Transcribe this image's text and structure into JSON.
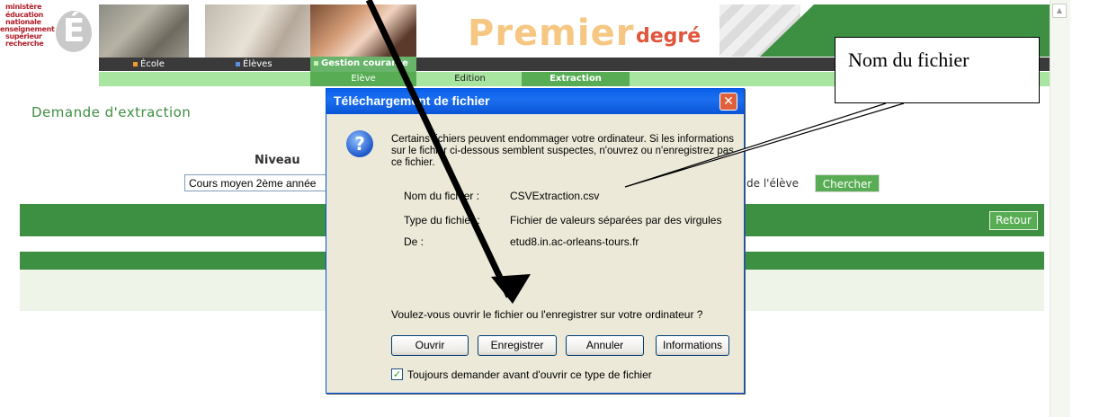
{
  "header": {
    "logo_lines": [
      "ministère",
      "éducation",
      "nationale",
      "enseignement",
      "supérieur",
      "recherche"
    ],
    "logo_letter": "É",
    "title_main": "Premier",
    "title_sub": "degré",
    "nav": [
      "École",
      "Élèves",
      "Gestion courante"
    ],
    "subnav": [
      "Elève",
      "Edition",
      "Extraction"
    ],
    "colors": {
      "accent_green": "#3d8f42",
      "light_green": "#a8e5a0",
      "title_orange": "#f6c783",
      "title_red": "#e0553b"
    }
  },
  "page": {
    "heading": "Demande d'extraction",
    "niveau_label": "Niveau",
    "niveau_value": "Cours moyen 2ème année",
    "eleve_label": "de l'élève",
    "chercher_label": "Chercher",
    "retour_label": "Retour"
  },
  "dialog": {
    "title": "Téléchargement de fichier",
    "warning_text": "Certains fichiers peuvent endommager votre ordinateur. Si les informations sur le fichier ci-dessous semblent suspectes, n'ouvrez ou n'enregistrez pas ce fichier.",
    "fields": [
      {
        "label": "Nom du fichier :",
        "value": "CSVExtraction.csv"
      },
      {
        "label": "Type du fichier :",
        "value": "Fichier de valeurs séparées par des virgules"
      },
      {
        "label": "De :",
        "value": "etud8.in.ac-orleans-tours.fr"
      }
    ],
    "question": "Voulez-vous ouvrir le fichier ou l'enregistrer sur votre ordinateur ?",
    "buttons": {
      "open": "Ouvrir",
      "save": "Enregistrer",
      "cancel": "Annuler",
      "info": "Informations"
    },
    "always_ask_label": "Toujours demander avant d'ouvrir ce type de fichier",
    "always_ask_checked": true
  },
  "callout": {
    "text": "Nom du fichier"
  }
}
